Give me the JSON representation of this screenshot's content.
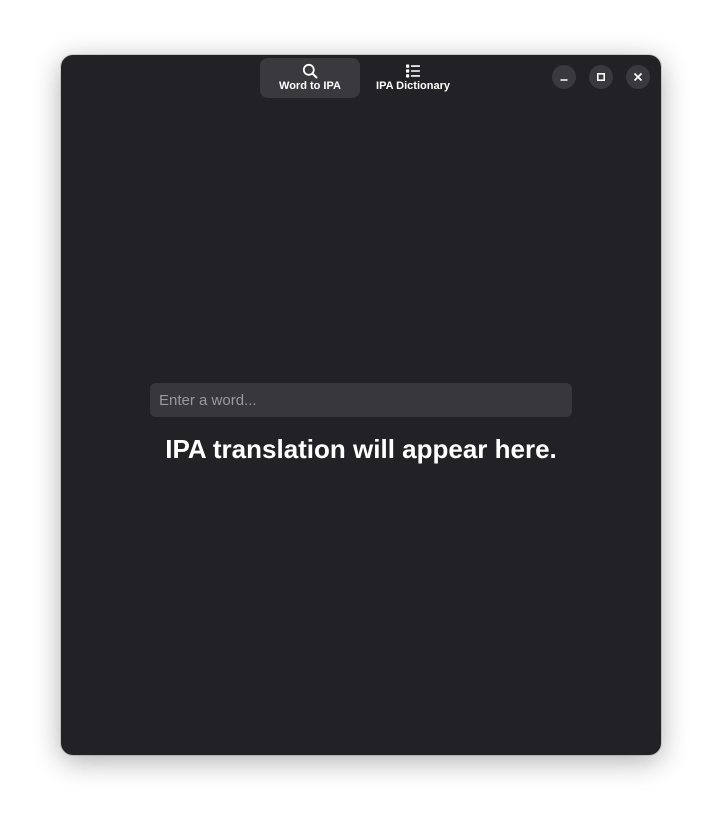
{
  "window": {
    "background": "#222226",
    "accent_tab_bg": "#3a3a3e"
  },
  "header": {
    "tabs": [
      {
        "label": "Word to IPA",
        "icon": "search-icon",
        "active": true
      },
      {
        "label": "IPA Dictionary",
        "icon": "list-icon",
        "active": false
      }
    ],
    "controls": [
      {
        "icon": "minimize-icon"
      },
      {
        "icon": "maximize-icon"
      },
      {
        "icon": "close-icon"
      }
    ]
  },
  "main": {
    "input": {
      "value": "",
      "placeholder": "Enter a word..."
    },
    "result_text": "IPA translation will appear here."
  }
}
